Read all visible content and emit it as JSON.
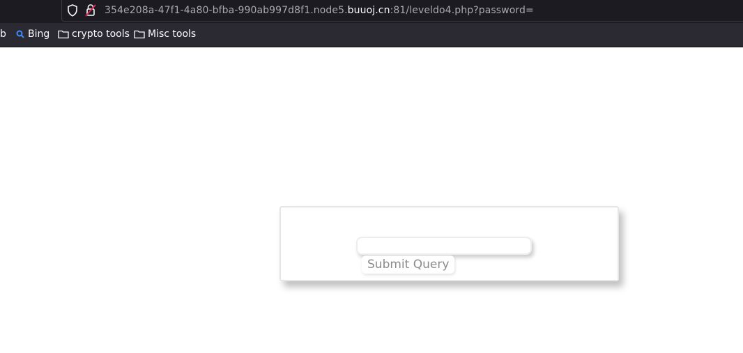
{
  "browser": {
    "url_prefix": "354e208a-47f1-4a80-bfba-990ab997d8f1.node5.",
    "url_host": "buuoj.cn",
    "url_suffix": ":81/leveldo4.php?password=",
    "bookmarks": {
      "partial_label": "b",
      "bing_label": "Bing",
      "crypto_label": "crypto tools",
      "misc_label": "Misc tools"
    }
  },
  "form": {
    "password_value": "",
    "submit_label": "Submit Query"
  },
  "colors": {
    "toolbar_bg": "#2b2a33",
    "urlbar_bg": "#1c1b22",
    "url_text": "#a9a9b1",
    "host_text": "#fbfbfe",
    "bing_icon": "#3d8bf7"
  }
}
